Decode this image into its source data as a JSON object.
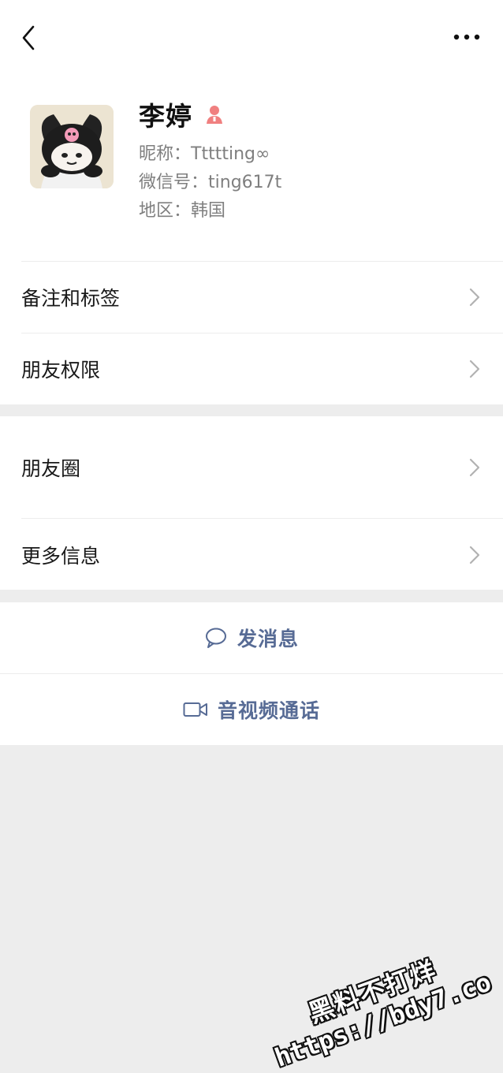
{
  "nav": {
    "back_icon": "chevron-left-icon",
    "more_icon": "more-dots-icon"
  },
  "profile": {
    "name": "李婷",
    "gender_icon": "female-icon",
    "gender_color": "#fa5151",
    "nickname_label": "昵称：",
    "nickname": "Ttttting∞",
    "wechat_id_label": "微信号：",
    "wechat_id": "ting617t",
    "region_label": "地区：",
    "region": "韩国"
  },
  "menu_group1": [
    {
      "label": "备注和标签"
    },
    {
      "label": "朋友权限"
    }
  ],
  "menu_group2": [
    {
      "label": "朋友圈"
    },
    {
      "label": "更多信息"
    }
  ],
  "actions": {
    "message_label": "发消息",
    "message_icon": "chat-bubble-icon",
    "call_label": "音视频通话",
    "call_icon": "video-camera-icon",
    "accent_color": "#576b95"
  },
  "watermark": {
    "line1": "黑料不打烊",
    "line2": "https://bdy7.co"
  }
}
